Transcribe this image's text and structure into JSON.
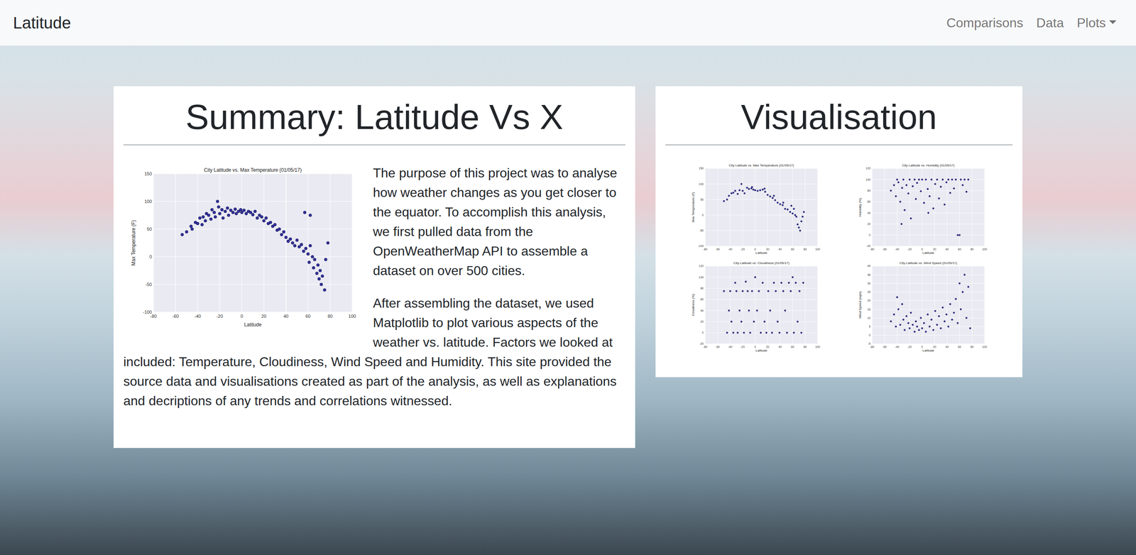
{
  "navbar": {
    "brand": "Latitude",
    "links": [
      {
        "label": "Comparisons",
        "kind": "link"
      },
      {
        "label": "Data",
        "kind": "link"
      },
      {
        "label": "Plots",
        "kind": "dropdown"
      }
    ]
  },
  "summary": {
    "title": "Summary: Latitude Vs X",
    "chart": {
      "title": "City Latitude vs. Max Temperature (01/05/17)",
      "x_label": "Latitude",
      "y_label": "Max Temperature (F)",
      "x_ticks": [
        "-80",
        "-60",
        "-40",
        "-20",
        "0",
        "20",
        "40",
        "60",
        "80",
        "100"
      ],
      "y_ticks": [
        "-100",
        "-50",
        "0",
        "50",
        "100",
        "150"
      ],
      "points": [
        [
          -54,
          40
        ],
        [
          -50,
          45
        ],
        [
          -46,
          55
        ],
        [
          -45,
          50
        ],
        [
          -42,
          62
        ],
        [
          -40,
          60
        ],
        [
          -38,
          70
        ],
        [
          -36,
          58
        ],
        [
          -35,
          72
        ],
        [
          -33,
          65
        ],
        [
          -32,
          78
        ],
        [
          -30,
          75
        ],
        [
          -28,
          68
        ],
        [
          -27,
          85
        ],
        [
          -25,
          80
        ],
        [
          -24,
          72
        ],
        [
          -22,
          100
        ],
        [
          -21,
          90
        ],
        [
          -20,
          78
        ],
        [
          -18,
          85
        ],
        [
          -17,
          70
        ],
        [
          -15,
          82
        ],
        [
          -13,
          88
        ],
        [
          -12,
          75
        ],
        [
          -10,
          84
        ],
        [
          -8,
          80
        ],
        [
          -6,
          86
        ],
        [
          -5,
          78
        ],
        [
          -3,
          82
        ],
        [
          -1,
          85
        ],
        [
          0,
          80
        ],
        [
          2,
          84
        ],
        [
          4,
          78
        ],
        [
          6,
          82
        ],
        [
          8,
          80
        ],
        [
          10,
          76
        ],
        [
          12,
          82
        ],
        [
          14,
          70
        ],
        [
          16,
          75
        ],
        [
          18,
          72
        ],
        [
          20,
          65
        ],
        [
          22,
          70
        ],
        [
          24,
          60
        ],
        [
          26,
          62
        ],
        [
          28,
          55
        ],
        [
          30,
          58
        ],
        [
          32,
          48
        ],
        [
          34,
          50
        ],
        [
          36,
          40
        ],
        [
          38,
          45
        ],
        [
          40,
          35
        ],
        [
          42,
          28
        ],
        [
          44,
          32
        ],
        [
          46,
          25
        ],
        [
          48,
          20
        ],
        [
          50,
          30
        ],
        [
          52,
          18
        ],
        [
          54,
          22
        ],
        [
          56,
          10
        ],
        [
          58,
          15
        ],
        [
          60,
          5
        ],
        [
          61,
          -10
        ],
        [
          62,
          20
        ],
        [
          64,
          0
        ],
        [
          65,
          -20
        ],
        [
          66,
          -5
        ],
        [
          68,
          -30
        ],
        [
          69,
          -15
        ],
        [
          70,
          -40
        ],
        [
          71,
          -25
        ],
        [
          72,
          -50
        ],
        [
          73,
          -35
        ],
        [
          75,
          -60
        ],
        [
          76,
          -5
        ],
        [
          78,
          25
        ],
        [
          57,
          80
        ],
        [
          62,
          75
        ]
      ]
    },
    "paragraphs": [
      "The purpose of this project was to analyse how weather changes as you get closer to the equator. To accomplish this analysis, we first pulled data from the OpenWeatherMap API to assemble a dataset on over 500 cities.",
      "After assembling the dataset, we used Matplotlib to plot various aspects of the weather vs. latitude. Factors we looked at included: Temperature, Cloudiness, Wind Speed and Humidity. This site provided the source data and visualisations created as part of the analysis, as well as explanations and decriptions of any trends and correlations witnessed."
    ]
  },
  "visualisation": {
    "title": "Visualisation",
    "charts": [
      {
        "title": "City Latitude vs. Max Temperature (01/05/17)",
        "x_label": "Latitude",
        "y_label": "Max Temperature (F)",
        "x_ticks": [
          "-80",
          "-60",
          "-40",
          "-20",
          "0",
          "20",
          "40",
          "60",
          "80",
          "100"
        ],
        "y_ticks": [
          "-100",
          "-50",
          "0",
          "50",
          "100",
          "150"
        ],
        "points": [
          [
            -50,
            45
          ],
          [
            -45,
            50
          ],
          [
            -42,
            62
          ],
          [
            -38,
            70
          ],
          [
            -35,
            72
          ],
          [
            -32,
            78
          ],
          [
            -28,
            68
          ],
          [
            -25,
            80
          ],
          [
            -22,
            100
          ],
          [
            -20,
            78
          ],
          [
            -17,
            70
          ],
          [
            -13,
            88
          ],
          [
            -10,
            84
          ],
          [
            -6,
            86
          ],
          [
            -3,
            82
          ],
          [
            0,
            80
          ],
          [
            4,
            78
          ],
          [
            8,
            80
          ],
          [
            12,
            82
          ],
          [
            16,
            75
          ],
          [
            20,
            65
          ],
          [
            24,
            60
          ],
          [
            28,
            55
          ],
          [
            32,
            48
          ],
          [
            36,
            40
          ],
          [
            40,
            35
          ],
          [
            44,
            32
          ],
          [
            48,
            20
          ],
          [
            52,
            18
          ],
          [
            56,
            10
          ],
          [
            60,
            5
          ],
          [
            62,
            20
          ],
          [
            64,
            0
          ],
          [
            66,
            -5
          ],
          [
            68,
            -30
          ],
          [
            70,
            -40
          ],
          [
            72,
            -50
          ],
          [
            74,
            -20
          ],
          [
            76,
            -5
          ],
          [
            78,
            10
          ],
          [
            58,
            30
          ],
          [
            45,
            40
          ],
          [
            30,
            62
          ],
          [
            -5,
            90
          ],
          [
            15,
            85
          ]
        ]
      },
      {
        "title": "City Latitude vs. Humidity (01/05/17)",
        "x_label": "Latitude",
        "y_label": "Humidity (%)",
        "x_ticks": [
          "-80",
          "-60",
          "-40",
          "-20",
          "0",
          "20",
          "40",
          "60",
          "80",
          "100"
        ],
        "y_ticks": [
          "-20",
          "0",
          "20",
          "40",
          "60",
          "80",
          "100",
          "120"
        ],
        "points": [
          [
            -50,
            80
          ],
          [
            -45,
            90
          ],
          [
            -42,
            70
          ],
          [
            -40,
            100
          ],
          [
            -38,
            95
          ],
          [
            -35,
            60
          ],
          [
            -32,
            85
          ],
          [
            -30,
            100
          ],
          [
            -28,
            45
          ],
          [
            -25,
            90
          ],
          [
            -22,
            75
          ],
          [
            -20,
            100
          ],
          [
            -18,
            30
          ],
          [
            -15,
            88
          ],
          [
            -12,
            100
          ],
          [
            -10,
            65
          ],
          [
            -8,
            94
          ],
          [
            -5,
            100
          ],
          [
            -2,
            79
          ],
          [
            0,
            100
          ],
          [
            3,
            58
          ],
          [
            6,
            100
          ],
          [
            9,
            83
          ],
          [
            12,
            70
          ],
          [
            15,
            100
          ],
          [
            18,
            48
          ],
          [
            21,
            92
          ],
          [
            24,
            100
          ],
          [
            27,
            66
          ],
          [
            30,
            87
          ],
          [
            33,
            100
          ],
          [
            36,
            55
          ],
          [
            39,
            95
          ],
          [
            42,
            100
          ],
          [
            45,
            76
          ],
          [
            48,
            100
          ],
          [
            51,
            84
          ],
          [
            54,
            100
          ],
          [
            57,
            0
          ],
          [
            60,
            0
          ],
          [
            62,
            100
          ],
          [
            65,
            90
          ],
          [
            68,
            100
          ],
          [
            71,
            78
          ],
          [
            74,
            100
          ],
          [
            -33,
            20
          ],
          [
            10,
            40
          ]
        ]
      },
      {
        "title": "City Latitude vs. Cloudiness (01/05/17)",
        "x_label": "Latitude",
        "y_label": "Cloudiness (%)",
        "x_ticks": [
          "-80",
          "-60",
          "-40",
          "-20",
          "0",
          "20",
          "40",
          "60",
          "80",
          "100"
        ],
        "y_ticks": [
          "-20",
          "0",
          "20",
          "40",
          "60",
          "80",
          "100",
          "120"
        ],
        "points": [
          [
            -50,
            75
          ],
          [
            -45,
            0
          ],
          [
            -42,
            40
          ],
          [
            -40,
            75
          ],
          [
            -38,
            20
          ],
          [
            -35,
            0
          ],
          [
            -32,
            90
          ],
          [
            -30,
            75
          ],
          [
            -28,
            0
          ],
          [
            -25,
            40
          ],
          [
            -22,
            20
          ],
          [
            -20,
            75
          ],
          [
            -18,
            0
          ],
          [
            -15,
            92
          ],
          [
            -12,
            75
          ],
          [
            -10,
            40
          ],
          [
            -8,
            0
          ],
          [
            -5,
            75
          ],
          [
            -2,
            20
          ],
          [
            0,
            100
          ],
          [
            3,
            40
          ],
          [
            6,
            75
          ],
          [
            9,
            0
          ],
          [
            12,
            90
          ],
          [
            15,
            20
          ],
          [
            18,
            0
          ],
          [
            21,
            75
          ],
          [
            24,
            40
          ],
          [
            27,
            0
          ],
          [
            30,
            90
          ],
          [
            33,
            75
          ],
          [
            36,
            20
          ],
          [
            39,
            0
          ],
          [
            42,
            90
          ],
          [
            45,
            75
          ],
          [
            48,
            40
          ],
          [
            51,
            0
          ],
          [
            54,
            90
          ],
          [
            57,
            75
          ],
          [
            60,
            100
          ],
          [
            62,
            0
          ],
          [
            65,
            90
          ],
          [
            68,
            20
          ],
          [
            71,
            75
          ],
          [
            74,
            0
          ],
          [
            77,
            90
          ]
        ]
      },
      {
        "title": "City Latitude vs. Wind Speed (01/05/17)",
        "x_label": "Latitude",
        "y_label": "Wind Speed (mph)",
        "x_ticks": [
          "-80",
          "-60",
          "-40",
          "-20",
          "0",
          "20",
          "40",
          "60",
          "80",
          "100"
        ],
        "y_ticks": [
          "-5",
          "0",
          "5",
          "10",
          "15",
          "20",
          "25",
          "30",
          "35",
          "40"
        ],
        "points": [
          [
            -50,
            8
          ],
          [
            -45,
            12
          ],
          [
            -42,
            5
          ],
          [
            -40,
            22
          ],
          [
            -38,
            15
          ],
          [
            -35,
            6
          ],
          [
            -32,
            18
          ],
          [
            -30,
            9
          ],
          [
            -28,
            3
          ],
          [
            -25,
            11
          ],
          [
            -22,
            7
          ],
          [
            -20,
            4
          ],
          [
            -18,
            13
          ],
          [
            -15,
            6
          ],
          [
            -12,
            2
          ],
          [
            -10,
            8
          ],
          [
            -8,
            5
          ],
          [
            -5,
            3
          ],
          [
            -2,
            10
          ],
          [
            0,
            4
          ],
          [
            3,
            7
          ],
          [
            6,
            2
          ],
          [
            9,
            12
          ],
          [
            12,
            5
          ],
          [
            15,
            9
          ],
          [
            18,
            3
          ],
          [
            21,
            14
          ],
          [
            24,
            6
          ],
          [
            27,
            11
          ],
          [
            30,
            4
          ],
          [
            33,
            16
          ],
          [
            36,
            8
          ],
          [
            39,
            12
          ],
          [
            42,
            5
          ],
          [
            45,
            18
          ],
          [
            48,
            9
          ],
          [
            51,
            13
          ],
          [
            54,
            21
          ],
          [
            57,
            7
          ],
          [
            60,
            30
          ],
          [
            62,
            15
          ],
          [
            65,
            25
          ],
          [
            68,
            35
          ],
          [
            71,
            10
          ],
          [
            74,
            28
          ],
          [
            77,
            4
          ]
        ]
      }
    ]
  }
}
